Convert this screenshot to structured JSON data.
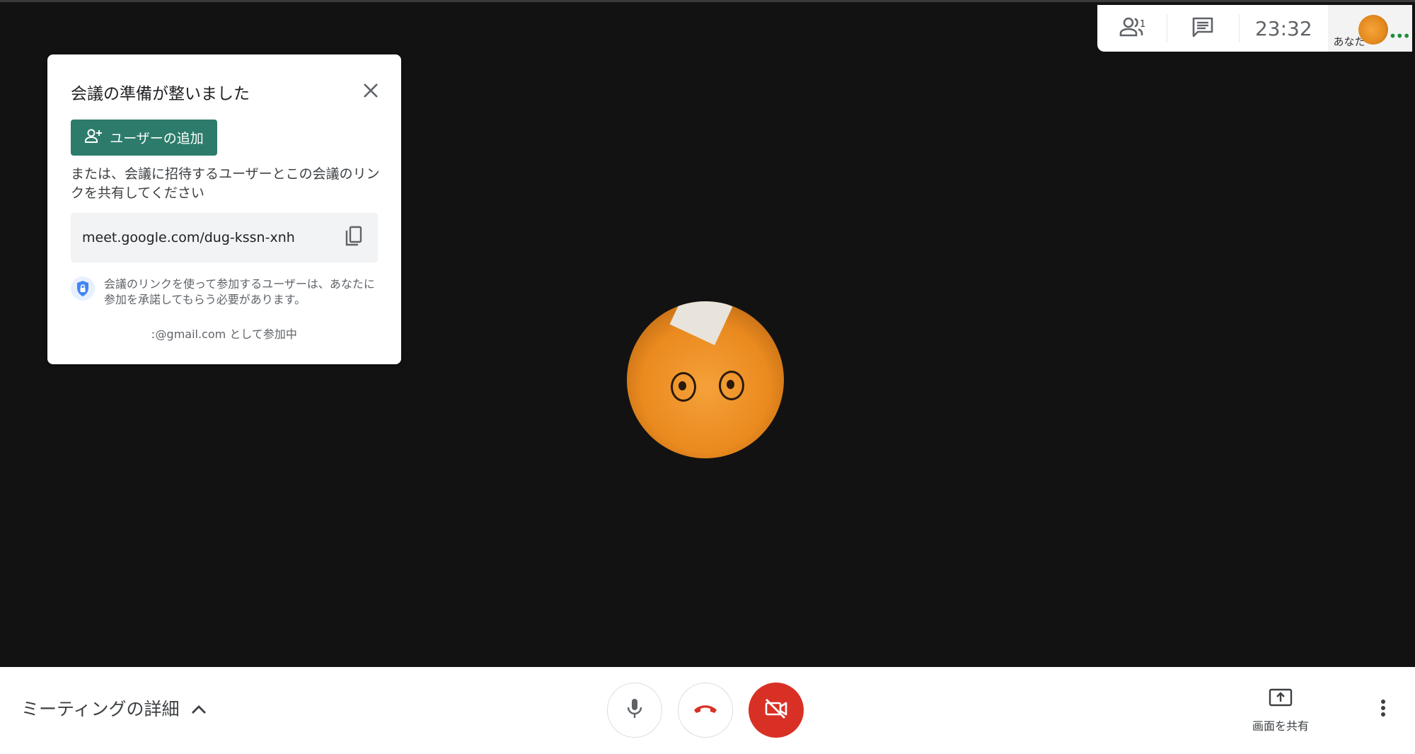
{
  "topbar": {
    "participants_count": "1",
    "time": "23:32",
    "self_label": "あなた"
  },
  "card": {
    "title": "会議の準備が整いました",
    "add_user_label": "ユーザーの追加",
    "description": "または、会議に招待するユーザーとこの会議のリンクを共有してください",
    "meeting_link": "meet.google.com/dug-kssn-xnh",
    "security_note": "会議のリンクを使って参加するユーザーは、あなたに参加を承諾してもらう必要があります。",
    "joined_as": "ː@gmail.com として参加中"
  },
  "bottombar": {
    "details_label": "ミーティングの詳細",
    "share_label": "画面を共有"
  },
  "colors": {
    "accent_green": "#2d7c6b",
    "danger_red": "#d93025",
    "stage_background": "#121212"
  },
  "icons": [
    "people-icon",
    "chat-icon",
    "close-icon",
    "add-person-icon",
    "copy-icon",
    "shield-lock-icon",
    "chevron-up-icon",
    "microphone-icon",
    "hangup-icon",
    "camera-off-icon",
    "present-screen-icon",
    "more-vert-icon"
  ]
}
